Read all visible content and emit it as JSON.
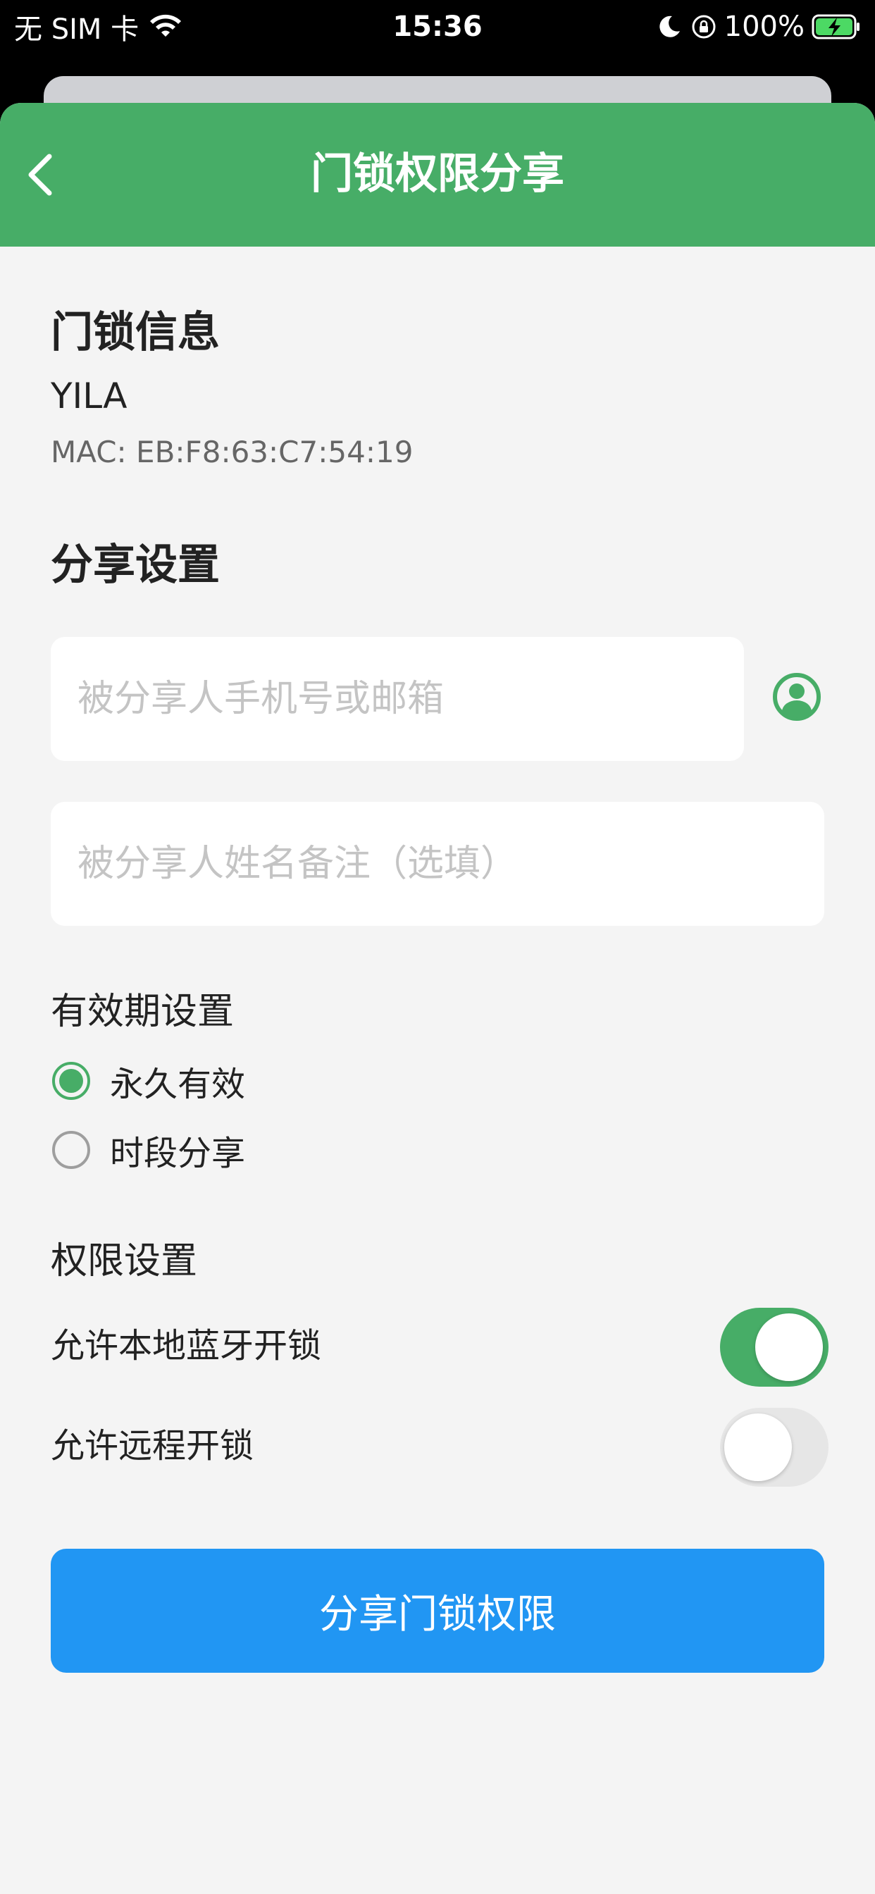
{
  "status_bar": {
    "carrier": "无 SIM 卡",
    "time": "15:36",
    "battery_percent": "100%"
  },
  "nav": {
    "title": "门锁权限分享"
  },
  "lock_info": {
    "section_title": "门锁信息",
    "name": "YILA",
    "mac": "MAC: EB:F8:63:C7:54:19"
  },
  "share_settings": {
    "section_title": "分享设置",
    "phone_placeholder": "被分享人手机号或邮箱",
    "phone_value": "",
    "name_placeholder": "被分享人姓名备注（选填）",
    "name_value": ""
  },
  "validity": {
    "label": "有效期设置",
    "options": [
      {
        "label": "永久有效",
        "selected": true
      },
      {
        "label": "时段分享",
        "selected": false
      }
    ]
  },
  "permissions": {
    "label": "权限设置",
    "items": [
      {
        "label": "允许本地蓝牙开锁",
        "enabled": true
      },
      {
        "label": "允许远程开锁",
        "enabled": false
      }
    ]
  },
  "share_button_label": "分享门锁权限",
  "colors": {
    "nav_green": "#47ad67",
    "button_blue": "#2196f3",
    "background": "#f4f4f4"
  }
}
